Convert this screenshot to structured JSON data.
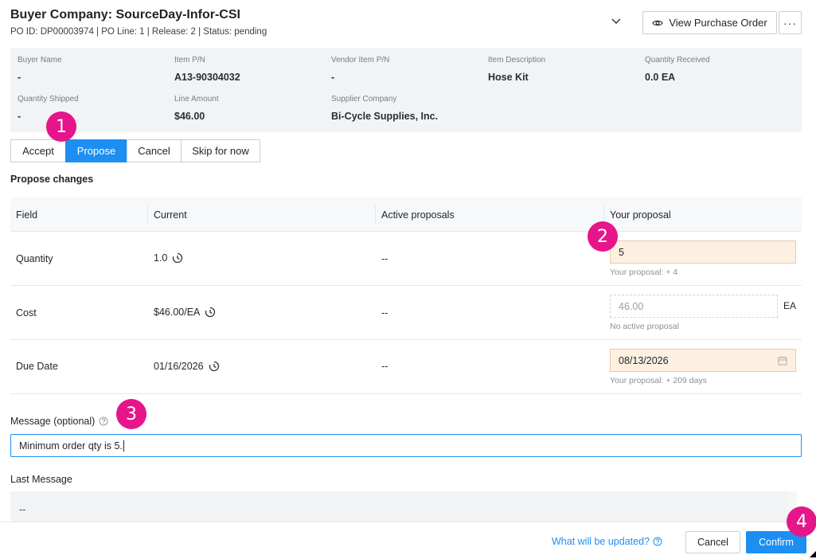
{
  "header": {
    "title": "Buyer Company: SourceDay-Infor-CSI",
    "subtitle": "PO ID: DP00003974 | PO Line: 1 | Release: 2 | Status: pending",
    "view_po_label": "View Purchase Order",
    "more_label": "···"
  },
  "info": {
    "buyer_name": {
      "label": "Buyer Name",
      "value": "-"
    },
    "item_pn": {
      "label": "Item P/N",
      "value": "A13-90304032"
    },
    "vendor_item_pn": {
      "label": "Vendor Item P/N",
      "value": "-"
    },
    "item_description": {
      "label": "Item Description",
      "value": "Hose Kit"
    },
    "quantity_received": {
      "label": "Quantity Received",
      "value": "0.0 EA"
    },
    "quantity_shipped": {
      "label": "Quantity Shipped",
      "value": "-"
    },
    "line_amount": {
      "label": "Line Amount",
      "value": "$46.00"
    },
    "supplier_company": {
      "label": "Supplier Company",
      "value": "Bi-Cycle Supplies, Inc."
    }
  },
  "action_tabs": [
    "Accept",
    "Propose",
    "Cancel",
    "Skip for now"
  ],
  "active_tab": "Propose",
  "section_title": "Propose changes",
  "table": {
    "headers": [
      "Field",
      "Current",
      "Active proposals",
      "Your proposal"
    ],
    "rows": [
      {
        "field": "Quantity",
        "current": "1.0",
        "active": "--",
        "proposal": "5",
        "hint": "Your proposal: + 4"
      },
      {
        "field": "Cost",
        "current": "$46.00/EA",
        "active": "--",
        "proposal_placeholder": "46.00",
        "unit": "EA",
        "hint": "No active proposal"
      },
      {
        "field": "Due Date",
        "current": "01/16/2026",
        "active": "--",
        "proposal": "08/13/2026",
        "hint": "Your proposal: + 209 days"
      }
    ]
  },
  "message": {
    "label": "Message (optional)",
    "value": "Minimum order qty is 5."
  },
  "last_message": {
    "label": "Last Message",
    "value": "--"
  },
  "footer": {
    "what_link": "What will be updated?",
    "cancel_label": "Cancel",
    "confirm_label": "Confirm"
  },
  "markers": [
    "1",
    "2",
    "3",
    "4"
  ],
  "colors": {
    "accent": "#1d8ff2",
    "marker": "#e6158a",
    "highlight_input": "#fdf0e1"
  }
}
